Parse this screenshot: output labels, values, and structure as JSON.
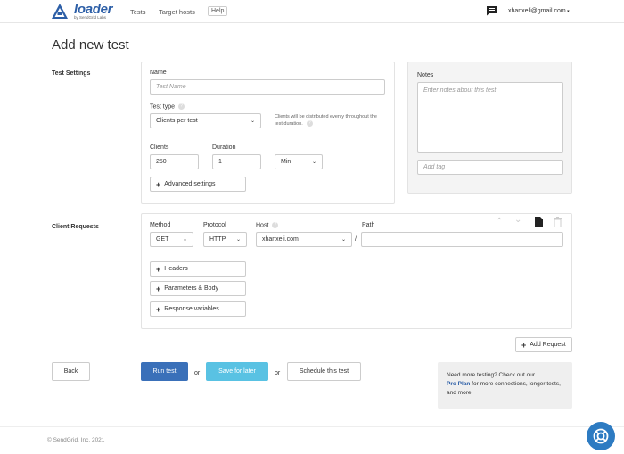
{
  "header": {
    "logo_text": "loader",
    "logo_sub": "by SendGrid Labs",
    "nav_tests": "Tests",
    "nav_target_hosts": "Target hosts",
    "nav_help": "Help",
    "user_email": "xhanxeli@gmail.com"
  },
  "page_title": "Add new test",
  "test_settings": {
    "section_label": "Test Settings",
    "name_label": "Name",
    "name_placeholder": "Test Name",
    "test_type_label": "Test type",
    "test_type_value": "Clients per test",
    "test_type_note": "Clients will be distributed evenly throughout the test duration.",
    "clients_label": "Clients",
    "clients_value": "250",
    "duration_label": "Duration",
    "duration_value": "1",
    "duration_unit": "Min",
    "advanced_settings": "Advanced settings"
  },
  "notes": {
    "label": "Notes",
    "placeholder": "Enter notes about this test",
    "tag_placeholder": "Add tag"
  },
  "client_requests": {
    "section_label": "Client Requests",
    "method_label": "Method",
    "method_value": "GET",
    "protocol_label": "Protocol",
    "protocol_value": "HTTP",
    "host_label": "Host",
    "host_value": "xhanxeli.com",
    "path_label": "Path",
    "path_separator": "/",
    "headers": "Headers",
    "parameters_body": "Parameters & Body",
    "response_variables": "Response variables",
    "add_request": "Add Request"
  },
  "actions": {
    "back": "Back",
    "run_test": "Run test",
    "or1": "or",
    "save_for_later": "Save for later",
    "or2": "or",
    "schedule": "Schedule this test"
  },
  "promo": {
    "line1": "Need more testing? Check out our",
    "pro_plan": "Pro Plan",
    "line2": " for more connections, longer tests, and more!"
  },
  "footer": "© SendGrid, Inc. 2021",
  "colors": {
    "brand": "#2d5fa7",
    "primary": "#3a70b9",
    "info": "#59c2e3",
    "support": "#2d7bc2"
  }
}
